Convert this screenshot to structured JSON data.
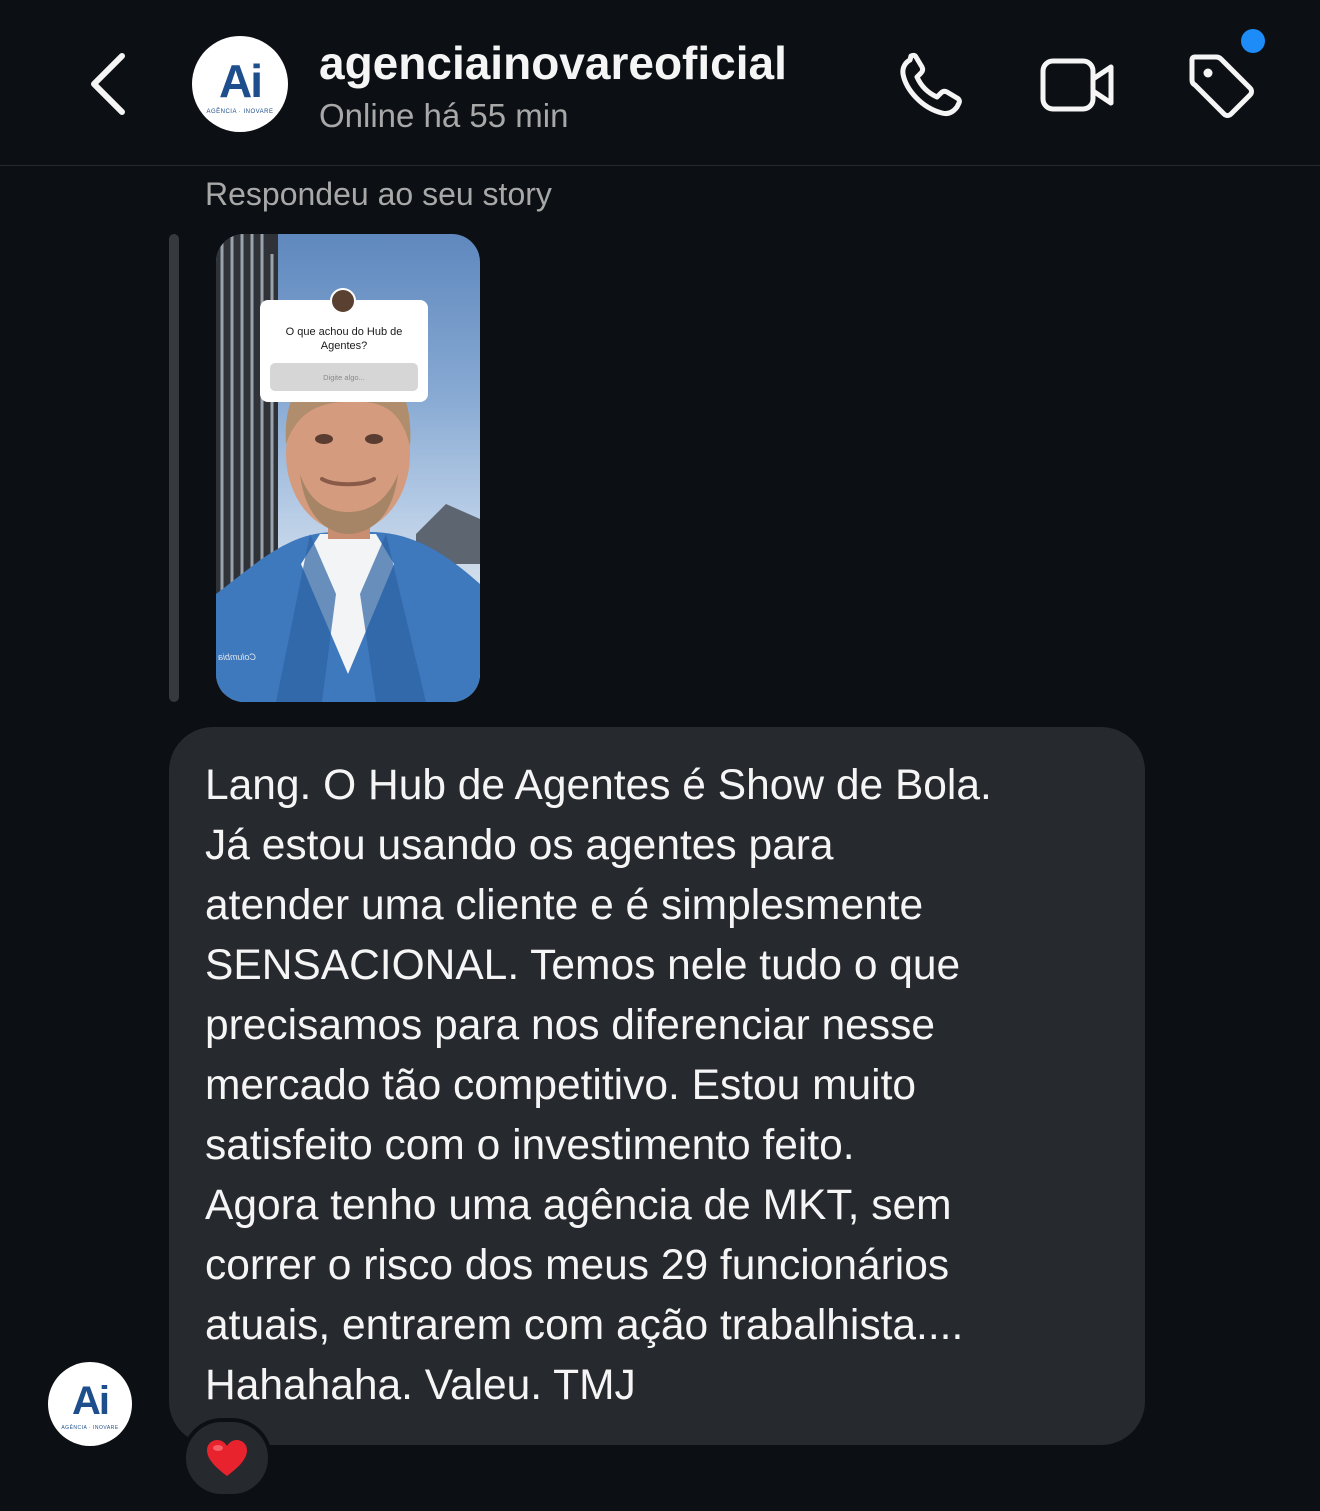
{
  "header": {
    "username": "agenciainovareoficial",
    "status": "Online há 55 min",
    "avatar_monogram": "Ai",
    "avatar_subtitle": "AGÊNCIA · INOVARE",
    "icons": [
      "back-chevron",
      "phone",
      "video-camera",
      "tag"
    ],
    "notification_dot_color": "#1d8cf8"
  },
  "story_reply": {
    "label": "Respondeu ao seu story",
    "question": "O que achou do Hub de Agentes?",
    "input_placeholder": "Digite algo...",
    "brand_mark": "Columbia"
  },
  "message": {
    "lines": [
      "Lang. O Hub de Agentes é Show de Bola.",
      "Já estou usando os agentes para",
      "atender uma cliente e é simplesmente",
      "SENSACIONAL. Temos nele tudo o que",
      "precisamos para nos diferenciar nesse",
      "mercado tão competitivo. Estou muito",
      "satisfeito com o investimento feito.",
      "Agora tenho uma agência de MKT, sem",
      "correr o risco dos meus 29 funcionários",
      "atuais, entrarem com ação trabalhista....",
      "Hahahaha. Valeu. TMJ"
    ],
    "reaction": "heart"
  },
  "colors": {
    "background": "#0c1014",
    "bubble": "#26292e",
    "brand_blue": "#1e4f8c",
    "reaction_red": "#e8232e"
  }
}
